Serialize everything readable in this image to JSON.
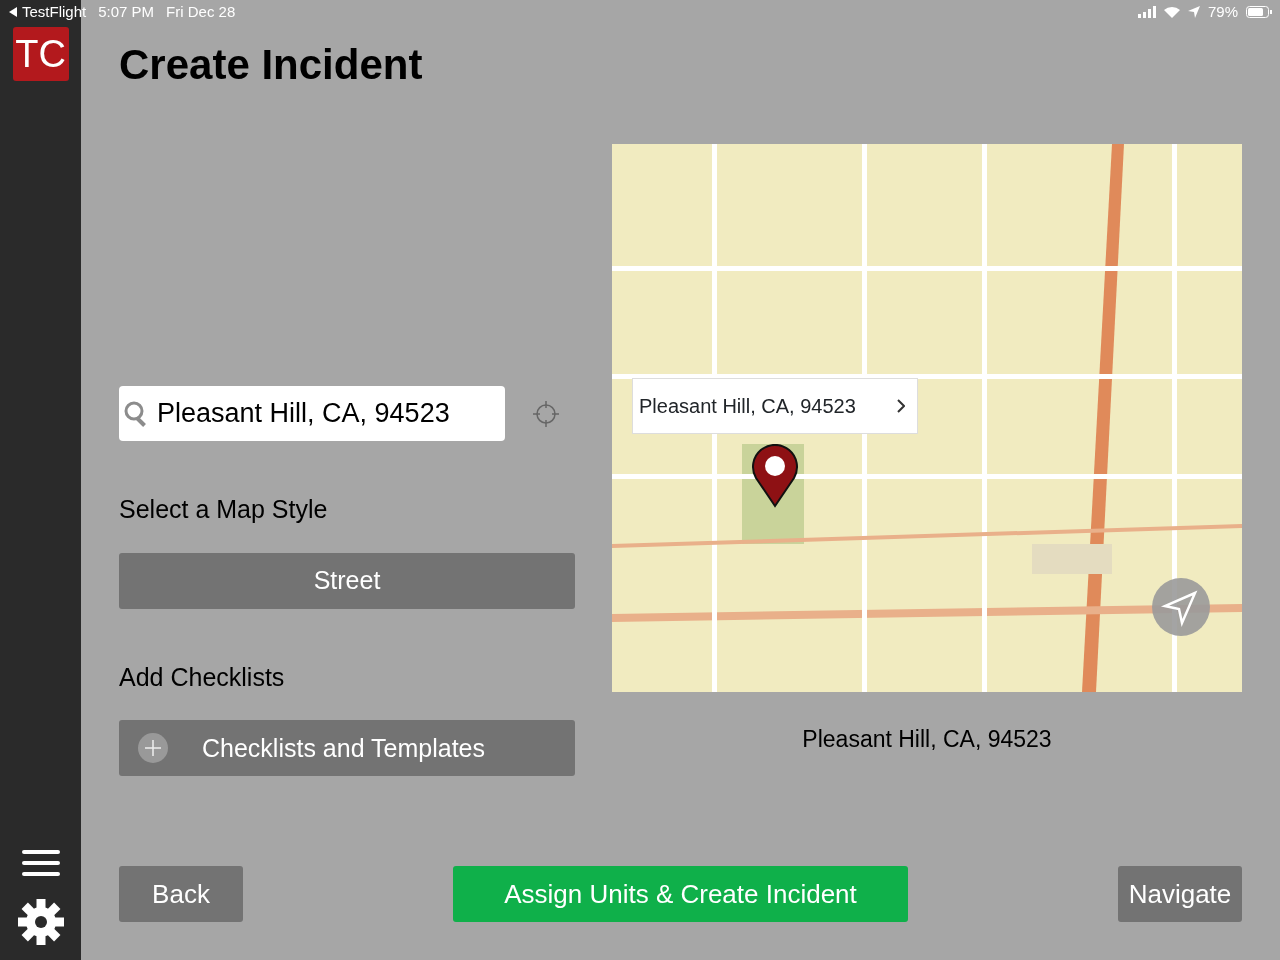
{
  "status_bar": {
    "back_app": "TestFlight",
    "time": "5:07 PM",
    "date": "Fri Dec 28",
    "battery": "79%"
  },
  "sidebar": {
    "logo": "TC"
  },
  "title": "Create Incident",
  "search": {
    "value": "Pleasant Hill, CA, 94523"
  },
  "map_style": {
    "label": "Select a Map Style",
    "button": "Street"
  },
  "checklists": {
    "label": "Add Checklists",
    "button": "Checklists and Templates"
  },
  "map": {
    "kind": "picture",
    "callout": "Pleasant Hill, CA, 94523",
    "caption": "Pleasant Hill, CA, 94523"
  },
  "buttons": [
    {
      "label": "Back",
      "kind": "secondary"
    },
    {
      "label": "Assign Units & Create Incident",
      "kind": "primary"
    },
    {
      "label": "Navigate",
      "kind": "secondary"
    }
  ]
}
